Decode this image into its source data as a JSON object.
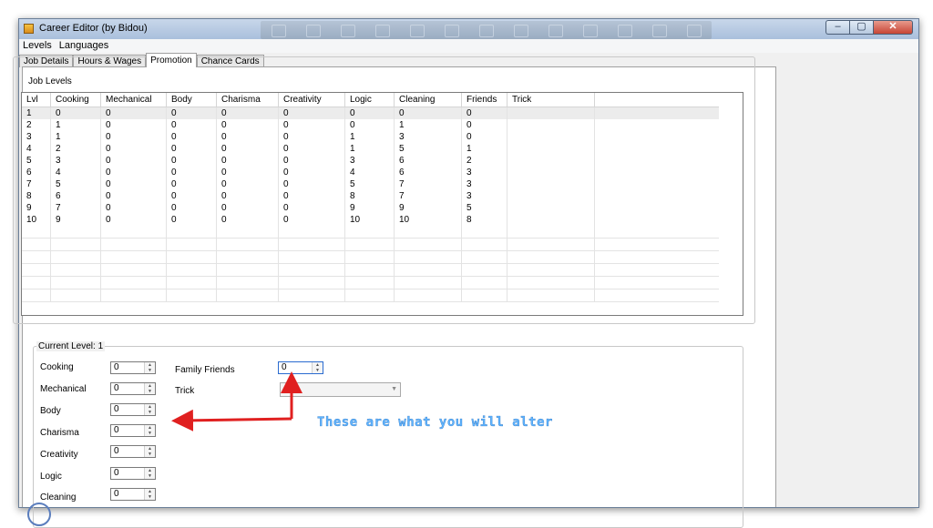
{
  "window": {
    "title": "Career Editor (by Bidou)"
  },
  "window_controls": {
    "min": "–",
    "max": "▢",
    "close": "✕"
  },
  "menu": [
    "Levels",
    "Languages"
  ],
  "tabs": [
    "Job Details",
    "Hours & Wages",
    "Promotion",
    "Chance Cards"
  ],
  "active_tab": "Promotion",
  "job_levels": {
    "group_label": "Job Levels",
    "columns": [
      "Lvl",
      "Cooking",
      "Mechanical",
      "Body",
      "Charisma",
      "Creativity",
      "Logic",
      "Cleaning",
      "Friends",
      "Trick"
    ],
    "rows": [
      [
        "1",
        "0",
        "0",
        "0",
        "0",
        "0",
        "0",
        "0",
        "0",
        ""
      ],
      [
        "2",
        "1",
        "0",
        "0",
        "0",
        "0",
        "0",
        "1",
        "0",
        ""
      ],
      [
        "3",
        "1",
        "0",
        "0",
        "0",
        "0",
        "1",
        "3",
        "0",
        ""
      ],
      [
        "4",
        "2",
        "0",
        "0",
        "0",
        "0",
        "1",
        "5",
        "1",
        ""
      ],
      [
        "5",
        "3",
        "0",
        "0",
        "0",
        "0",
        "3",
        "6",
        "2",
        ""
      ],
      [
        "6",
        "4",
        "0",
        "0",
        "0",
        "0",
        "4",
        "6",
        "3",
        ""
      ],
      [
        "7",
        "5",
        "0",
        "0",
        "0",
        "0",
        "5",
        "7",
        "3",
        ""
      ],
      [
        "8",
        "6",
        "0",
        "0",
        "0",
        "0",
        "8",
        "7",
        "3",
        ""
      ],
      [
        "9",
        "7",
        "0",
        "0",
        "0",
        "0",
        "9",
        "9",
        "5",
        ""
      ],
      [
        "10",
        "9",
        "0",
        "0",
        "0",
        "0",
        "10",
        "10",
        "8",
        ""
      ]
    ]
  },
  "current_level": {
    "group_label": "Current Level: 1",
    "fields": [
      {
        "label": "Cooking",
        "value": "0"
      },
      {
        "label": "Mechanical",
        "value": "0"
      },
      {
        "label": "Body",
        "value": "0"
      },
      {
        "label": "Charisma",
        "value": "0"
      },
      {
        "label": "Creativity",
        "value": "0"
      },
      {
        "label": "Logic",
        "value": "0"
      },
      {
        "label": "Cleaning",
        "value": "0"
      }
    ],
    "family_friends_label": "Family Friends",
    "family_friends_value": "0",
    "trick_label": "Trick",
    "trick_value": ""
  },
  "annotation": "These are what you will alter",
  "colors": {
    "annotation": "#5fb4ff",
    "arrow": "#e02020"
  }
}
